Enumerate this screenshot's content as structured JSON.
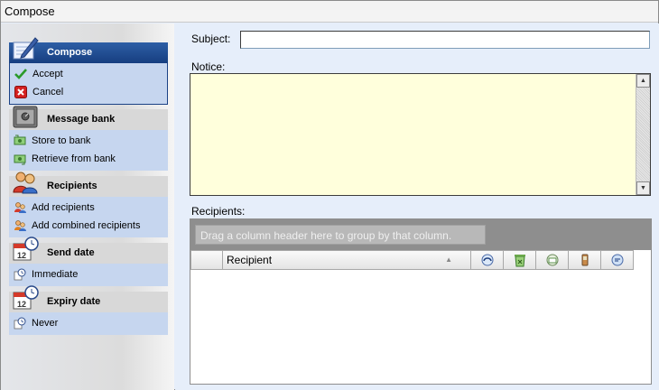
{
  "window": {
    "title": "Compose"
  },
  "sidebar": {
    "groups": [
      {
        "title": "Compose",
        "icon": "compose-pen-icon",
        "active": true,
        "items": [
          {
            "label": "Accept",
            "icon": "checkmark-icon"
          },
          {
            "label": "Cancel",
            "icon": "cancel-x-icon"
          }
        ]
      },
      {
        "title": "Message bank",
        "icon": "safe-icon",
        "items": [
          {
            "label": "Store to bank",
            "icon": "bank-store-icon"
          },
          {
            "label": "Retrieve from bank",
            "icon": "bank-retrieve-icon"
          }
        ]
      },
      {
        "title": "Recipients",
        "icon": "users-icon",
        "items": [
          {
            "label": "Add recipients",
            "icon": "add-user-icon"
          },
          {
            "label": "Add combined recipients",
            "icon": "add-group-icon"
          }
        ]
      },
      {
        "title": "Send date",
        "icon": "calendar-clock-icon",
        "items": [
          {
            "label": "Immediate",
            "icon": "clock-icon"
          }
        ]
      },
      {
        "title": "Expiry date",
        "icon": "calendar-clock-icon",
        "items": [
          {
            "label": "Never",
            "icon": "clock-icon"
          }
        ]
      }
    ]
  },
  "form": {
    "subject_label": "Subject:",
    "subject_value": "",
    "notice_label": "Notice:",
    "notice_value": "",
    "recipients_label": "Recipients:"
  },
  "grid": {
    "group_hint": "Drag a column header here to group by that column.",
    "columns": [
      {
        "label": ""
      },
      {
        "label": "Recipient"
      },
      {
        "label": "",
        "icon": "phone-receive-icon"
      },
      {
        "label": "",
        "icon": "recycle-bin-icon"
      },
      {
        "label": "",
        "icon": "email-send-icon"
      },
      {
        "label": "",
        "icon": "mobile-phone-icon"
      },
      {
        "label": "",
        "icon": "message-bubble-icon"
      }
    ],
    "rows": []
  },
  "colors": {
    "active_header": "#1f4c94",
    "group_body": "#c6d6ef",
    "notice_bg": "#ffffdc",
    "group_panel": "#8e8e8e"
  }
}
